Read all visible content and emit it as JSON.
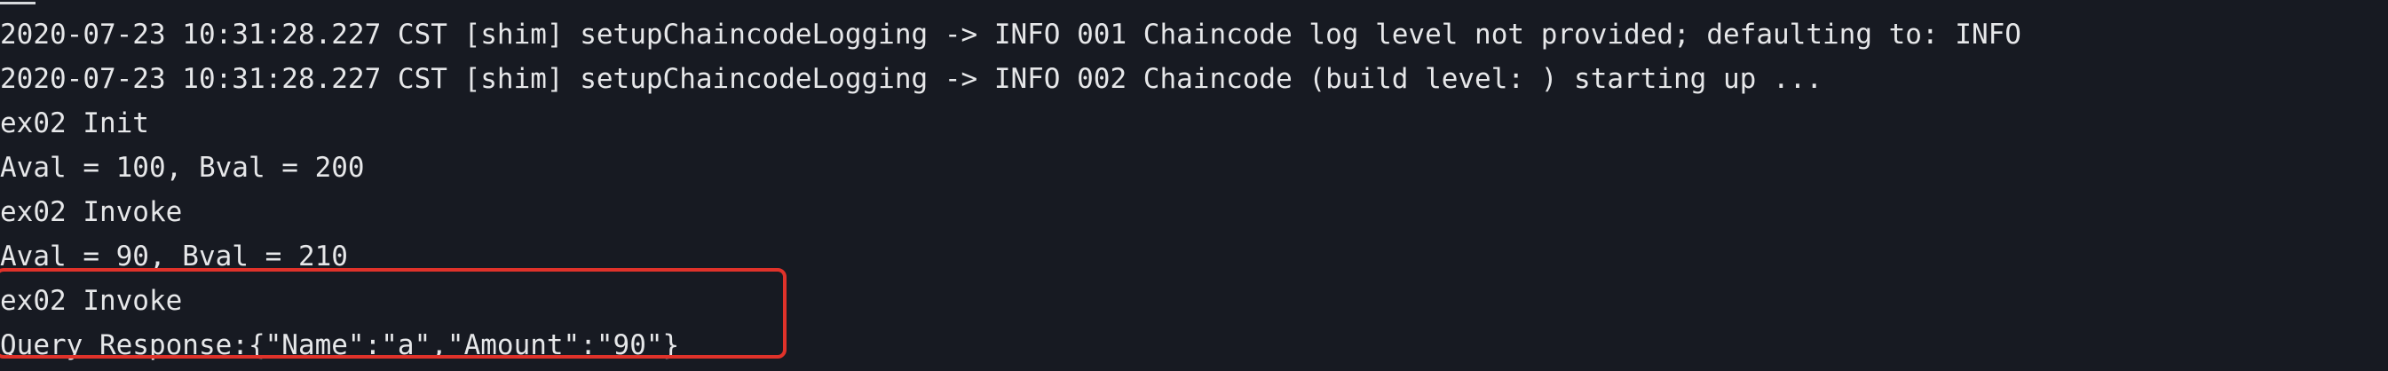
{
  "terminal": {
    "lines": [
      "2020-07-23 10:31:28.227 CST [shim] setupChaincodeLogging -> INFO 001 Chaincode log level not provided; defaulting to: INFO",
      "2020-07-23 10:31:28.227 CST [shim] setupChaincodeLogging -> INFO 002 Chaincode (build level: ) starting up ...",
      "ex02 Init",
      "Aval = 100, Bval = 200",
      "ex02 Invoke",
      "Aval = 90, Bval = 210",
      "ex02 Invoke",
      "Query Response:{\"Name\":\"a\",\"Amount\":\"90\"}"
    ]
  },
  "colors": {
    "background": "#171a22",
    "text": "#e6e7e9",
    "highlight": "#e0322a"
  }
}
